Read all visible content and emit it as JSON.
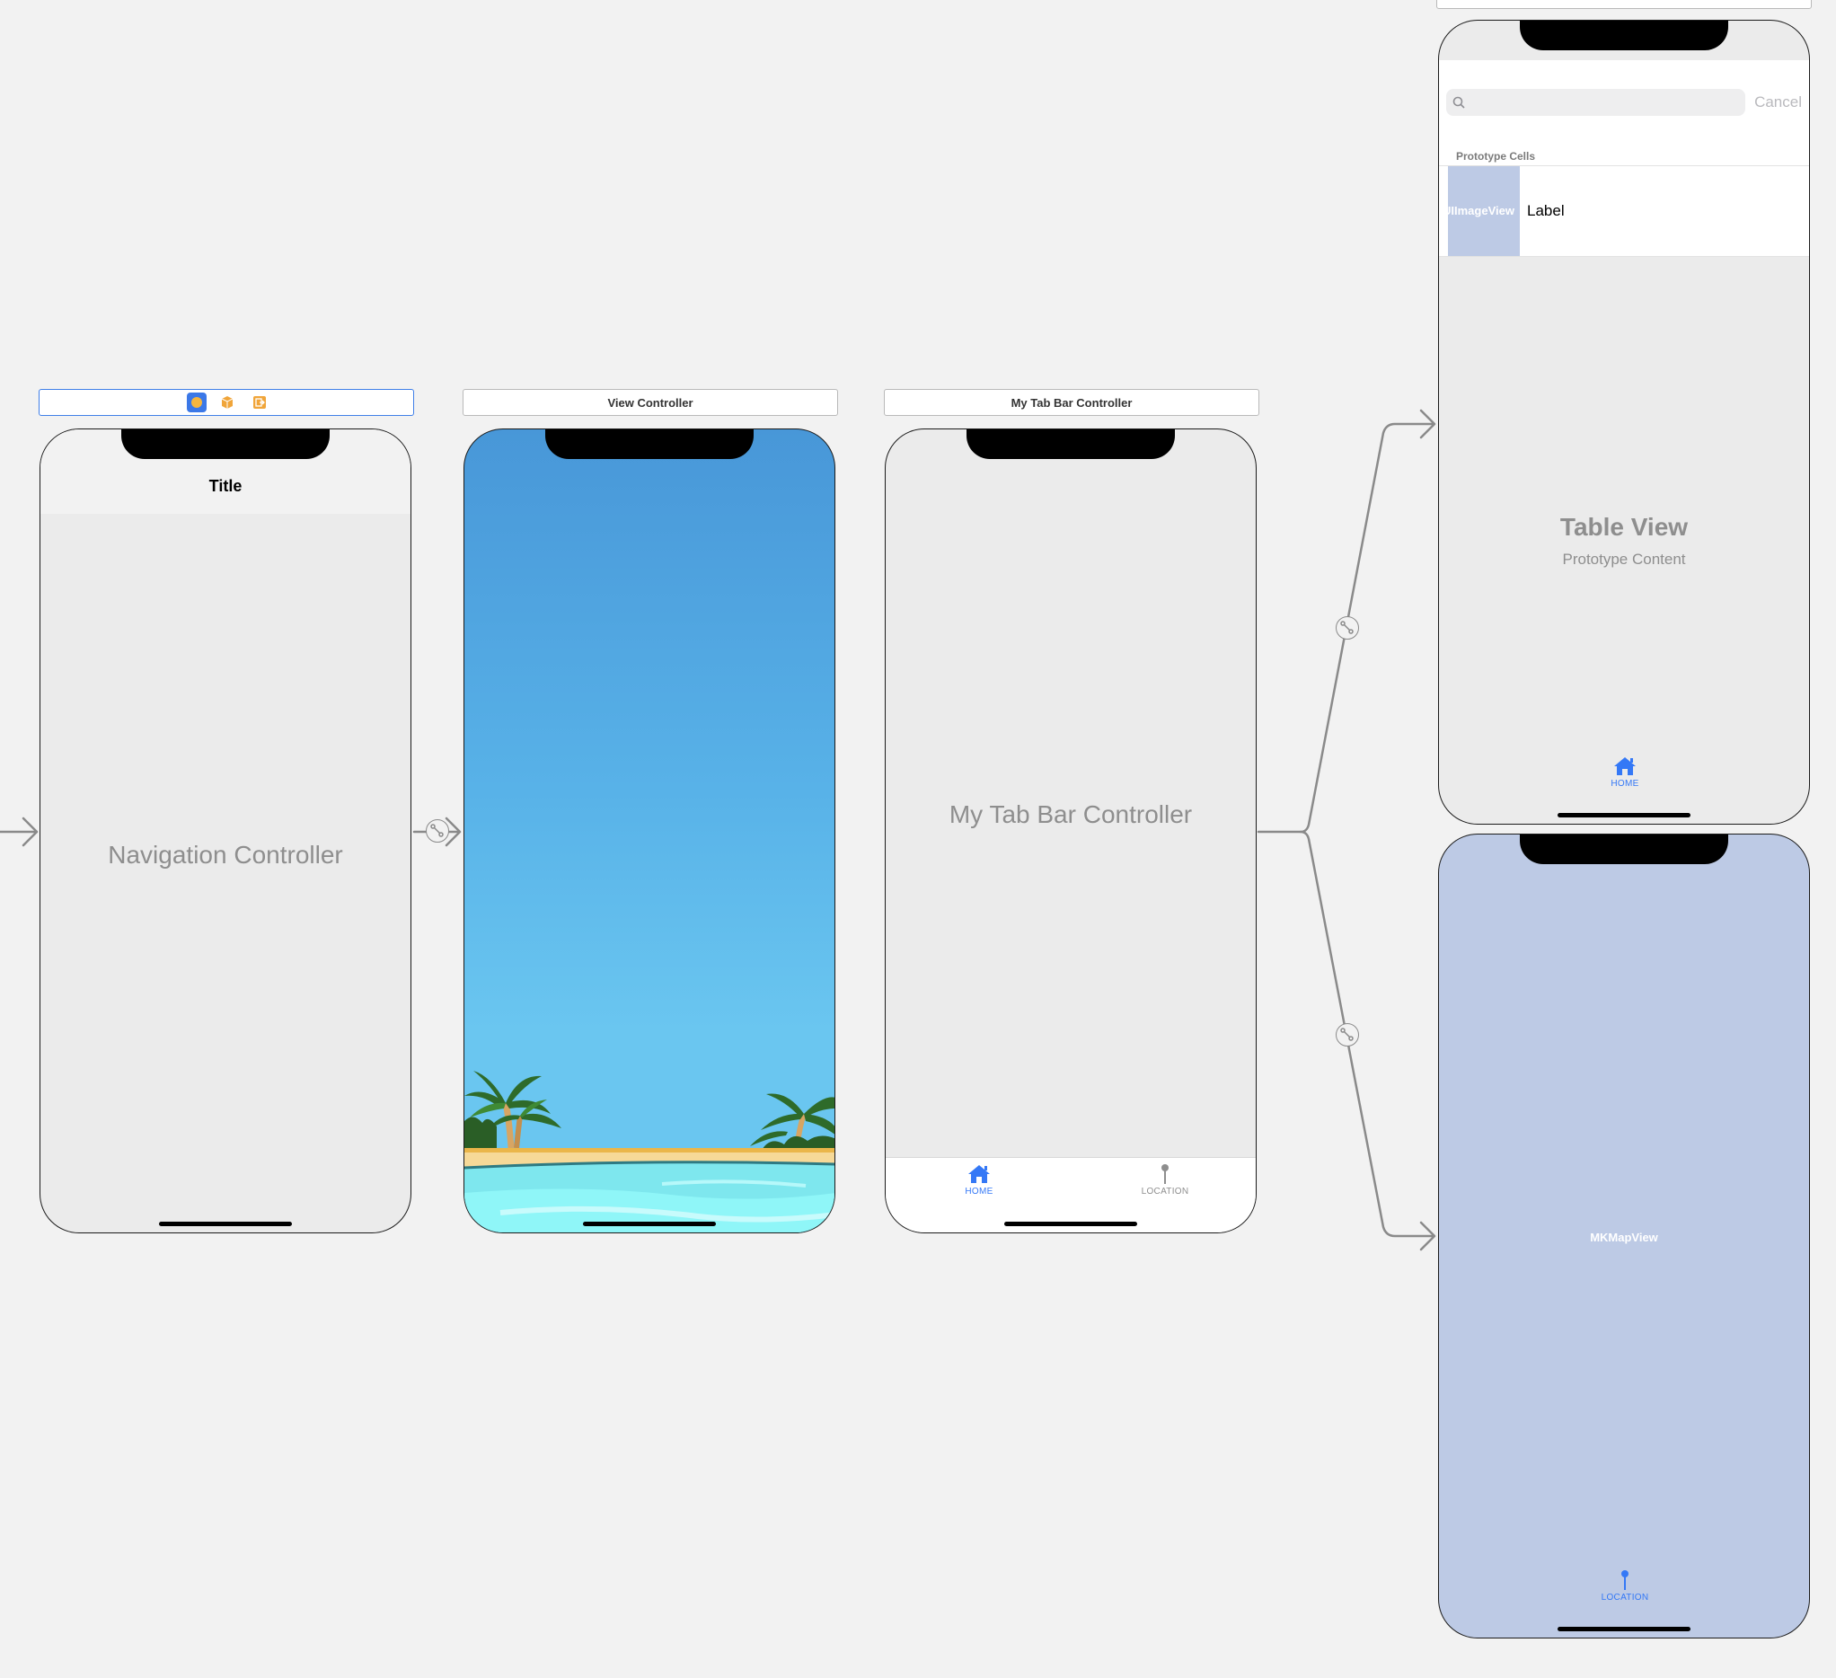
{
  "canvas": {
    "background": "#f2f2f2"
  },
  "navigation_controller": {
    "scene_bar_icons": [
      "first-responder-icon",
      "cube-icon",
      "exit-icon"
    ],
    "nav_title": "Title",
    "placeholder": "Navigation Controller"
  },
  "view_controller": {
    "scene_title": "View Controller",
    "background_image": "beach-palm-trees-image",
    "sky_top": "#4897d8",
    "sky_bottom": "#6ac6f0",
    "sand": "#f6d998",
    "water": "#8ff6f8"
  },
  "tab_bar_controller": {
    "scene_title": "My Tab Bar Controller",
    "placeholder": "My Tab Bar Controller",
    "tabs": [
      {
        "label": "HOME",
        "icon": "house-icon",
        "selected": true
      },
      {
        "label": "LOCATION",
        "icon": "pin-icon",
        "selected": false
      }
    ]
  },
  "table_view_controller": {
    "search_cancel": "Cancel",
    "section_header": "Prototype Cells",
    "cell_image": "UIImageView",
    "cell_label": "Label",
    "placeholder_title": "Table View",
    "placeholder_subtitle": "Prototype Content",
    "tab_label": "HOME"
  },
  "map_view_controller": {
    "map_label": "MKMapView",
    "tab_label": "LOCATION",
    "background": "#bdcae5"
  },
  "colors": {
    "accent": "#3478f6",
    "segue": "#8a8a8a",
    "tab_inactive": "#8e8e8e"
  }
}
